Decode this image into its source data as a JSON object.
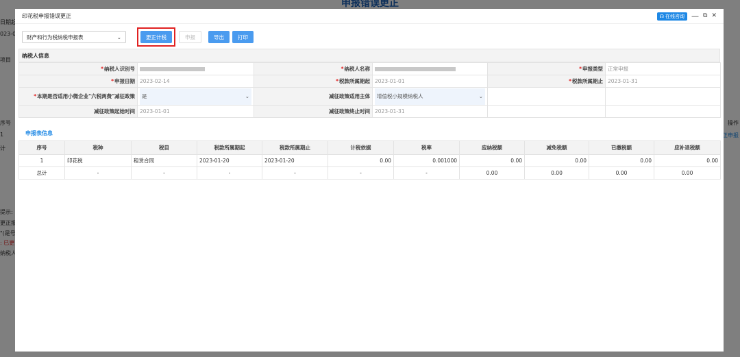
{
  "background": {
    "page_title": "申报错误更正",
    "left_labels": [
      "日期起",
      "023-01",
      "项目",
      "序号",
      "1",
      "计",
      "提示:",
      "更正报",
      "\"(是号",
      ": 已更",
      "纳税人"
    ],
    "right_labels": [
      "操作",
      "正申报"
    ]
  },
  "modal": {
    "title": "印花税申报错误更正",
    "consult_label": "在线咨询",
    "minimize_icon": "—",
    "maximize_icon": "⧉",
    "close_icon": "✕"
  },
  "toolbar": {
    "form_select": "财产和行为税纳税申报表",
    "correct_label": "更正计税",
    "declare_label": "申报",
    "export_label": "导出",
    "print_label": "打印"
  },
  "taxpayer": {
    "section_title": "纳税人信息",
    "id_label": "纳税人识别号",
    "name_label": "纳税人名称",
    "decl_type_label": "申报类型",
    "decl_type_value": "正常申报",
    "decl_date_label": "申报日期",
    "decl_date_value": "2023-02-14",
    "period_start_label": "税款所属期起",
    "period_start_value": "2023-01-01",
    "period_end_label": "税款所属期止",
    "period_end_value": "2023-01-31",
    "small_biz_label": "本期是否适用小微企业\"六税两费\"减征政策",
    "small_biz_value": "是",
    "subject_label": "减征政策适用主体",
    "subject_value": "增值税小规模纳税人",
    "policy_start_label": "减征政策起始时间",
    "policy_start_value": "2023-01-01",
    "policy_end_label": "减征政策终止时间",
    "policy_end_value": "2023-01-31"
  },
  "declaration": {
    "section_title": "申报表信息",
    "columns": [
      "序号",
      "税种",
      "税目",
      "税款所属期起",
      "税款所属期止",
      "计税依据",
      "税率",
      "应纳税额",
      "减免税额",
      "已缴税额",
      "应补退税额"
    ],
    "rows": [
      [
        "1",
        "印花税",
        "租赁合同",
        "2023-01-20",
        "2023-01-20",
        "0.00",
        "0.001000",
        "0.00",
        "0.00",
        "0.00",
        "0.00"
      ]
    ],
    "total": [
      "总计",
      "-",
      "-",
      "-",
      "-",
      "-",
      "-",
      "0.00",
      "0.00",
      "0.00",
      "0.00"
    ]
  }
}
